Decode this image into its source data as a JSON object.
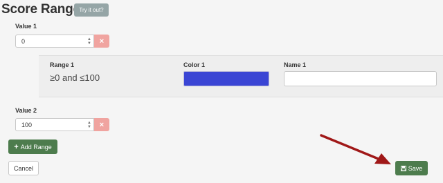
{
  "header": {
    "title": "Score Ranges",
    "try_label": "Try it out?"
  },
  "value1": {
    "label": "Value 1",
    "value": "0",
    "delete_symbol": "×"
  },
  "range": {
    "range_label": "Range 1",
    "range_text": "≥0 and ≤100",
    "color_label": "Color 1",
    "color_value": "#3a45d4",
    "name_label": "Name 1",
    "name_value": ""
  },
  "value2": {
    "label": "Value 2",
    "value": "100",
    "delete_symbol": "×"
  },
  "actions": {
    "add_range_label": "Add Range",
    "add_icon": "+",
    "cancel_label": "Cancel",
    "save_label": "Save",
    "save_icon": "floppy-disk-icon"
  },
  "colors": {
    "accent_green": "#4d7c4d",
    "delete_red": "#f0a4a0",
    "annotation_arrow": "#a01818"
  }
}
